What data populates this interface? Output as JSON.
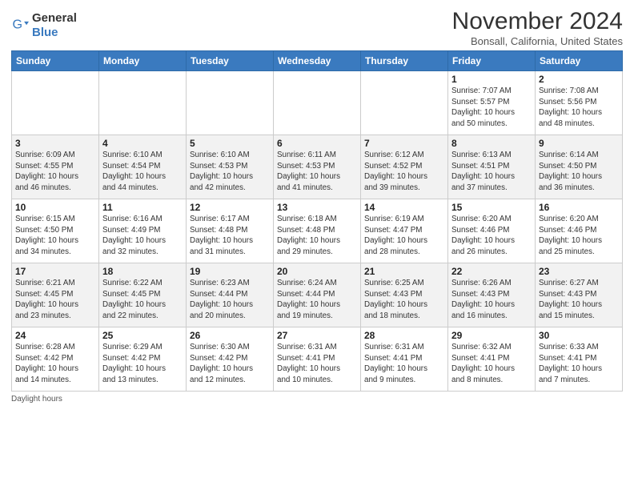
{
  "logo": {
    "general": "General",
    "blue": "Blue"
  },
  "header": {
    "month": "November 2024",
    "location": "Bonsall, California, United States"
  },
  "weekdays": [
    "Sunday",
    "Monday",
    "Tuesday",
    "Wednesday",
    "Thursday",
    "Friday",
    "Saturday"
  ],
  "weeks": [
    [
      {
        "day": "",
        "info": ""
      },
      {
        "day": "",
        "info": ""
      },
      {
        "day": "",
        "info": ""
      },
      {
        "day": "",
        "info": ""
      },
      {
        "day": "",
        "info": ""
      },
      {
        "day": "1",
        "info": "Sunrise: 7:07 AM\nSunset: 5:57 PM\nDaylight: 10 hours\nand 50 minutes."
      },
      {
        "day": "2",
        "info": "Sunrise: 7:08 AM\nSunset: 5:56 PM\nDaylight: 10 hours\nand 48 minutes."
      }
    ],
    [
      {
        "day": "3",
        "info": "Sunrise: 6:09 AM\nSunset: 4:55 PM\nDaylight: 10 hours\nand 46 minutes."
      },
      {
        "day": "4",
        "info": "Sunrise: 6:10 AM\nSunset: 4:54 PM\nDaylight: 10 hours\nand 44 minutes."
      },
      {
        "day": "5",
        "info": "Sunrise: 6:10 AM\nSunset: 4:53 PM\nDaylight: 10 hours\nand 42 minutes."
      },
      {
        "day": "6",
        "info": "Sunrise: 6:11 AM\nSunset: 4:53 PM\nDaylight: 10 hours\nand 41 minutes."
      },
      {
        "day": "7",
        "info": "Sunrise: 6:12 AM\nSunset: 4:52 PM\nDaylight: 10 hours\nand 39 minutes."
      },
      {
        "day": "8",
        "info": "Sunrise: 6:13 AM\nSunset: 4:51 PM\nDaylight: 10 hours\nand 37 minutes."
      },
      {
        "day": "9",
        "info": "Sunrise: 6:14 AM\nSunset: 4:50 PM\nDaylight: 10 hours\nand 36 minutes."
      }
    ],
    [
      {
        "day": "10",
        "info": "Sunrise: 6:15 AM\nSunset: 4:50 PM\nDaylight: 10 hours\nand 34 minutes."
      },
      {
        "day": "11",
        "info": "Sunrise: 6:16 AM\nSunset: 4:49 PM\nDaylight: 10 hours\nand 32 minutes."
      },
      {
        "day": "12",
        "info": "Sunrise: 6:17 AM\nSunset: 4:48 PM\nDaylight: 10 hours\nand 31 minutes."
      },
      {
        "day": "13",
        "info": "Sunrise: 6:18 AM\nSunset: 4:48 PM\nDaylight: 10 hours\nand 29 minutes."
      },
      {
        "day": "14",
        "info": "Sunrise: 6:19 AM\nSunset: 4:47 PM\nDaylight: 10 hours\nand 28 minutes."
      },
      {
        "day": "15",
        "info": "Sunrise: 6:20 AM\nSunset: 4:46 PM\nDaylight: 10 hours\nand 26 minutes."
      },
      {
        "day": "16",
        "info": "Sunrise: 6:20 AM\nSunset: 4:46 PM\nDaylight: 10 hours\nand 25 minutes."
      }
    ],
    [
      {
        "day": "17",
        "info": "Sunrise: 6:21 AM\nSunset: 4:45 PM\nDaylight: 10 hours\nand 23 minutes."
      },
      {
        "day": "18",
        "info": "Sunrise: 6:22 AM\nSunset: 4:45 PM\nDaylight: 10 hours\nand 22 minutes."
      },
      {
        "day": "19",
        "info": "Sunrise: 6:23 AM\nSunset: 4:44 PM\nDaylight: 10 hours\nand 20 minutes."
      },
      {
        "day": "20",
        "info": "Sunrise: 6:24 AM\nSunset: 4:44 PM\nDaylight: 10 hours\nand 19 minutes."
      },
      {
        "day": "21",
        "info": "Sunrise: 6:25 AM\nSunset: 4:43 PM\nDaylight: 10 hours\nand 18 minutes."
      },
      {
        "day": "22",
        "info": "Sunrise: 6:26 AM\nSunset: 4:43 PM\nDaylight: 10 hours\nand 16 minutes."
      },
      {
        "day": "23",
        "info": "Sunrise: 6:27 AM\nSunset: 4:43 PM\nDaylight: 10 hours\nand 15 minutes."
      }
    ],
    [
      {
        "day": "24",
        "info": "Sunrise: 6:28 AM\nSunset: 4:42 PM\nDaylight: 10 hours\nand 14 minutes."
      },
      {
        "day": "25",
        "info": "Sunrise: 6:29 AM\nSunset: 4:42 PM\nDaylight: 10 hours\nand 13 minutes."
      },
      {
        "day": "26",
        "info": "Sunrise: 6:30 AM\nSunset: 4:42 PM\nDaylight: 10 hours\nand 12 minutes."
      },
      {
        "day": "27",
        "info": "Sunrise: 6:31 AM\nSunset: 4:41 PM\nDaylight: 10 hours\nand 10 minutes."
      },
      {
        "day": "28",
        "info": "Sunrise: 6:31 AM\nSunset: 4:41 PM\nDaylight: 10 hours\nand 9 minutes."
      },
      {
        "day": "29",
        "info": "Sunrise: 6:32 AM\nSunset: 4:41 PM\nDaylight: 10 hours\nand 8 minutes."
      },
      {
        "day": "30",
        "info": "Sunrise: 6:33 AM\nSunset: 4:41 PM\nDaylight: 10 hours\nand 7 minutes."
      }
    ]
  ],
  "footer": {
    "note": "Daylight hours"
  }
}
